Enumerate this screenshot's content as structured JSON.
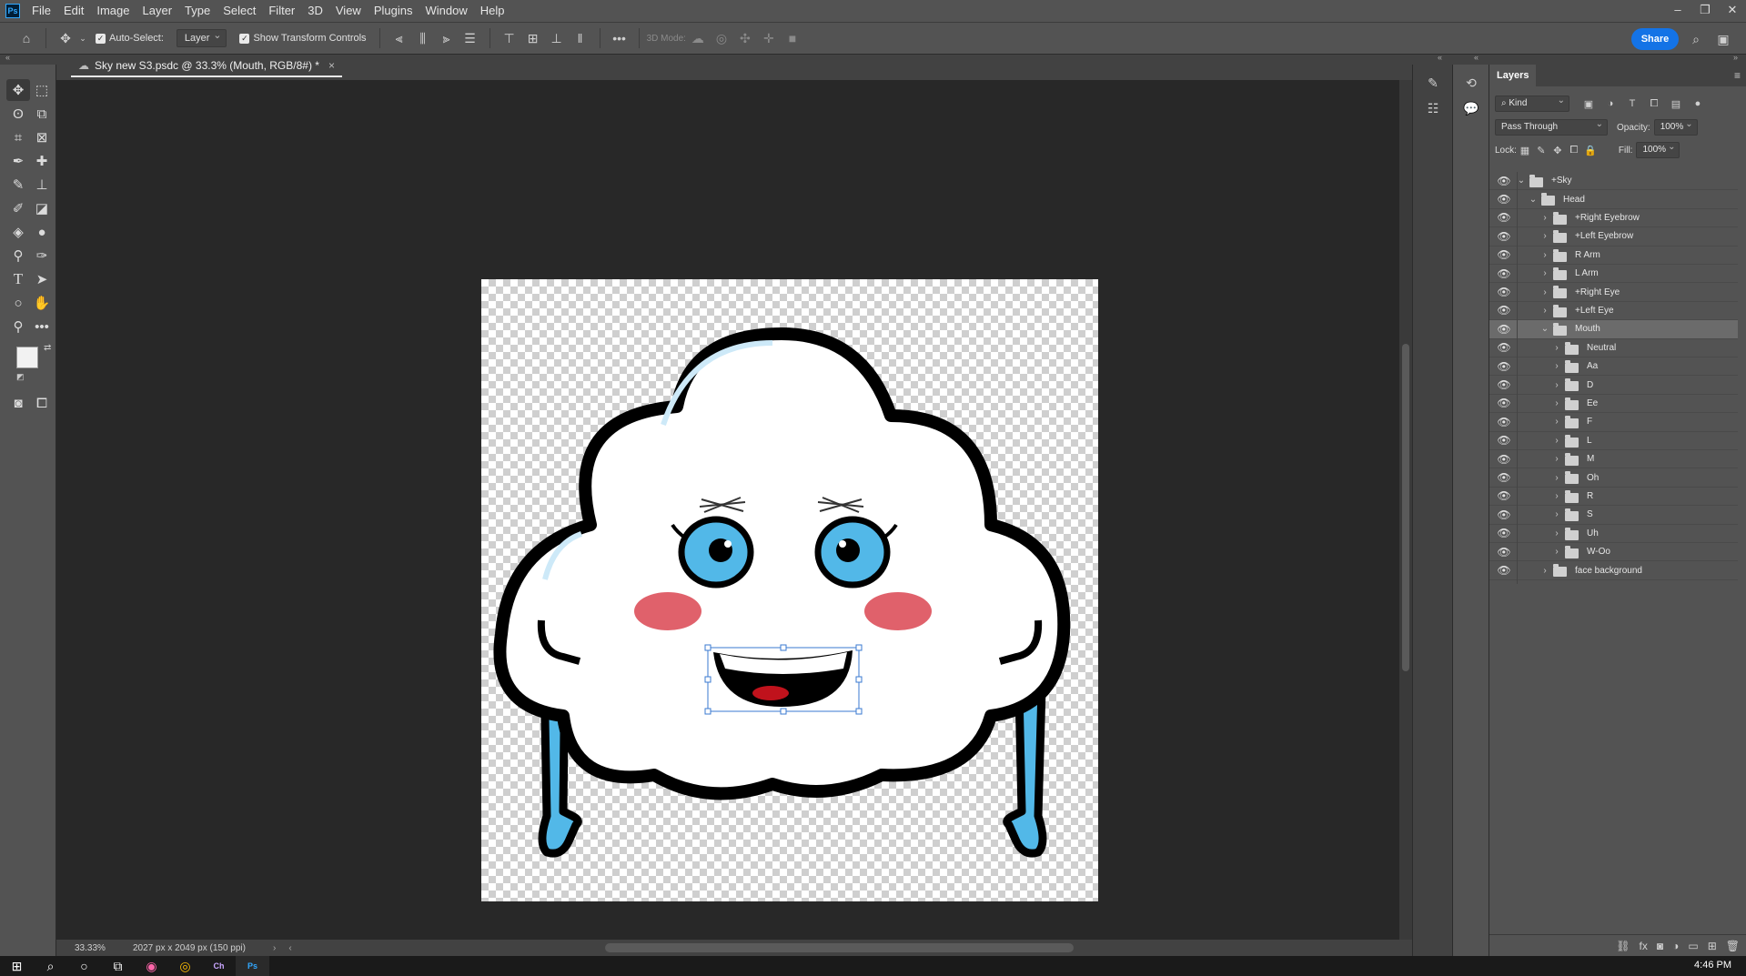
{
  "app": {
    "logo": "Ps"
  },
  "menu": [
    "File",
    "Edit",
    "Image",
    "Layer",
    "Type",
    "Select",
    "Filter",
    "3D",
    "View",
    "Plugins",
    "Window",
    "Help"
  ],
  "options_bar": {
    "auto_select_label": "Auto-Select:",
    "auto_select_target": "Layer",
    "transform_controls_label": "Show Transform Controls",
    "mode_3d_label": "3D Mode:",
    "share_label": "Share"
  },
  "document": {
    "tab_title": "Sky new S3.psdc @ 33.3% (Mouth, RGB/8#) *",
    "zoom": "33.33%",
    "dimensions": "2027 px x 2049 px (150 ppi)"
  },
  "layers_panel": {
    "tab": "Layers",
    "filter_kind": "Kind",
    "blend_mode": "Pass Through",
    "opacity_label": "Opacity:",
    "opacity_value": "100%",
    "lock_label": "Lock:",
    "fill_label": "Fill:",
    "fill_value": "100%",
    "layers": [
      {
        "name": "+Sky",
        "depth": 0,
        "expanded": true,
        "selected": false
      },
      {
        "name": "Head",
        "depth": 1,
        "expanded": true,
        "selected": false
      },
      {
        "name": "+Right Eyebrow",
        "depth": 2,
        "expanded": false,
        "selected": false
      },
      {
        "name": "+Left Eyebrow",
        "depth": 2,
        "expanded": false,
        "selected": false
      },
      {
        "name": "R Arm",
        "depth": 2,
        "expanded": false,
        "selected": false
      },
      {
        "name": "L Arm",
        "depth": 2,
        "expanded": false,
        "selected": false
      },
      {
        "name": "+Right Eye",
        "depth": 2,
        "expanded": false,
        "selected": false
      },
      {
        "name": "+Left Eye",
        "depth": 2,
        "expanded": false,
        "selected": false
      },
      {
        "name": "Mouth",
        "depth": 2,
        "expanded": true,
        "selected": true
      },
      {
        "name": "Neutral",
        "depth": 3,
        "expanded": false,
        "selected": false
      },
      {
        "name": "Aa",
        "depth": 3,
        "expanded": false,
        "selected": false
      },
      {
        "name": "D",
        "depth": 3,
        "expanded": false,
        "selected": false
      },
      {
        "name": "Ee",
        "depth": 3,
        "expanded": false,
        "selected": false
      },
      {
        "name": "F",
        "depth": 3,
        "expanded": false,
        "selected": false
      },
      {
        "name": "L",
        "depth": 3,
        "expanded": false,
        "selected": false
      },
      {
        "name": "M",
        "depth": 3,
        "expanded": false,
        "selected": false
      },
      {
        "name": "Oh",
        "depth": 3,
        "expanded": false,
        "selected": false
      },
      {
        "name": "R",
        "depth": 3,
        "expanded": false,
        "selected": false
      },
      {
        "name": "S",
        "depth": 3,
        "expanded": false,
        "selected": false
      },
      {
        "name": "Uh",
        "depth": 3,
        "expanded": false,
        "selected": false
      },
      {
        "name": "W-Oo",
        "depth": 3,
        "expanded": false,
        "selected": false
      },
      {
        "name": "face background",
        "depth": 2,
        "expanded": false,
        "selected": false
      }
    ]
  },
  "colors": {
    "foreground": "#f2f2f2",
    "background": "#0f6e9e",
    "accent": "#1473e6",
    "cloud_blue": "#52b8e8",
    "cheek": "#e0616b"
  },
  "taskbar": {
    "time": "4:46 PM"
  }
}
